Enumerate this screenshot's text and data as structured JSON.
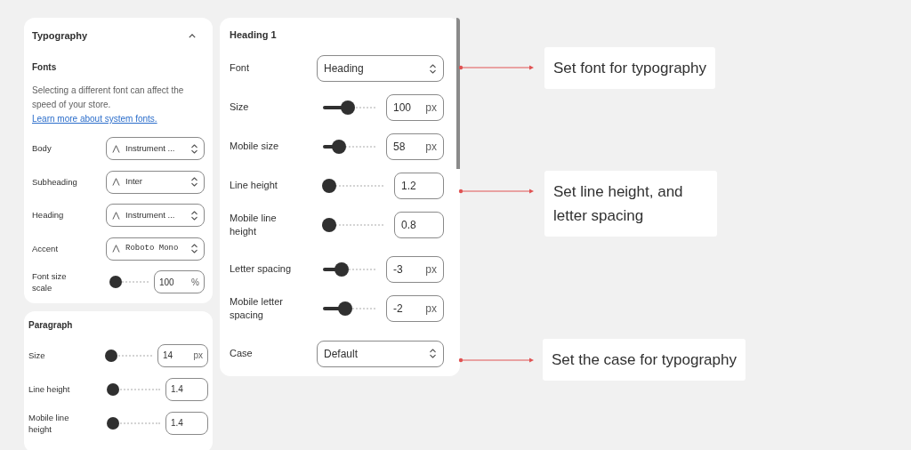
{
  "typography_panel": {
    "title": "Typography",
    "expanded": true,
    "fonts_heading": "Fonts",
    "description": "Selecting a different font can affect the speed of your store.",
    "link": "Learn more about system fonts.",
    "rows": [
      {
        "kind": "font_select",
        "label": "Body",
        "value": "Instrument ...",
        "monospace": false
      },
      {
        "kind": "font_select",
        "label": "Subheading",
        "value": "Inter",
        "monospace": false
      },
      {
        "kind": "font_select",
        "label": "Heading",
        "value": "Instrument ...",
        "monospace": false
      },
      {
        "kind": "font_select",
        "label": "Accent",
        "value": "Roboto Mono",
        "monospace": true
      },
      {
        "kind": "slider",
        "label": "Font size scale",
        "level": 0.1,
        "value": "100",
        "unit": "%"
      }
    ]
  },
  "paragraph_panel": {
    "title": "Paragraph",
    "rows": [
      {
        "kind": "slider",
        "label": "Size",
        "level": 0.07,
        "value": "14",
        "unit": "px"
      },
      {
        "kind": "slider",
        "label": "Line height",
        "level": 0.08,
        "value": "1.4"
      },
      {
        "kind": "slider",
        "label": "Mobile line height",
        "level": 0.08,
        "value": "1.4"
      }
    ]
  },
  "heading_panel": {
    "title": "Heading 1",
    "rows": [
      {
        "kind": "select",
        "label": "Font",
        "value": "Heading"
      },
      {
        "kind": "slider",
        "label": "Size",
        "level": 0.47,
        "value": "100",
        "unit": "px"
      },
      {
        "kind": "slider",
        "label": "Mobile size",
        "level": 0.3,
        "value": "58",
        "unit": "px"
      },
      {
        "kind": "slider",
        "label": "Line height",
        "level": 0.1,
        "value": "1.2"
      },
      {
        "kind": "slider",
        "label": "Mobile line height",
        "level": 0.1,
        "value": "0.8"
      },
      {
        "kind": "slider",
        "label": "Letter spacing",
        "level": 0.35,
        "value": "-3",
        "unit": "px"
      },
      {
        "kind": "slider",
        "label": "Mobile letter spacing",
        "level": 0.42,
        "value": "-2",
        "unit": "px"
      },
      {
        "kind": "select",
        "label": "Case",
        "value": "Default"
      }
    ]
  },
  "callouts": [
    {
      "text": "Set font for typography"
    },
    {
      "text": "Set line height, and letter spacing"
    },
    {
      "text": "Set the case for typography"
    }
  ]
}
